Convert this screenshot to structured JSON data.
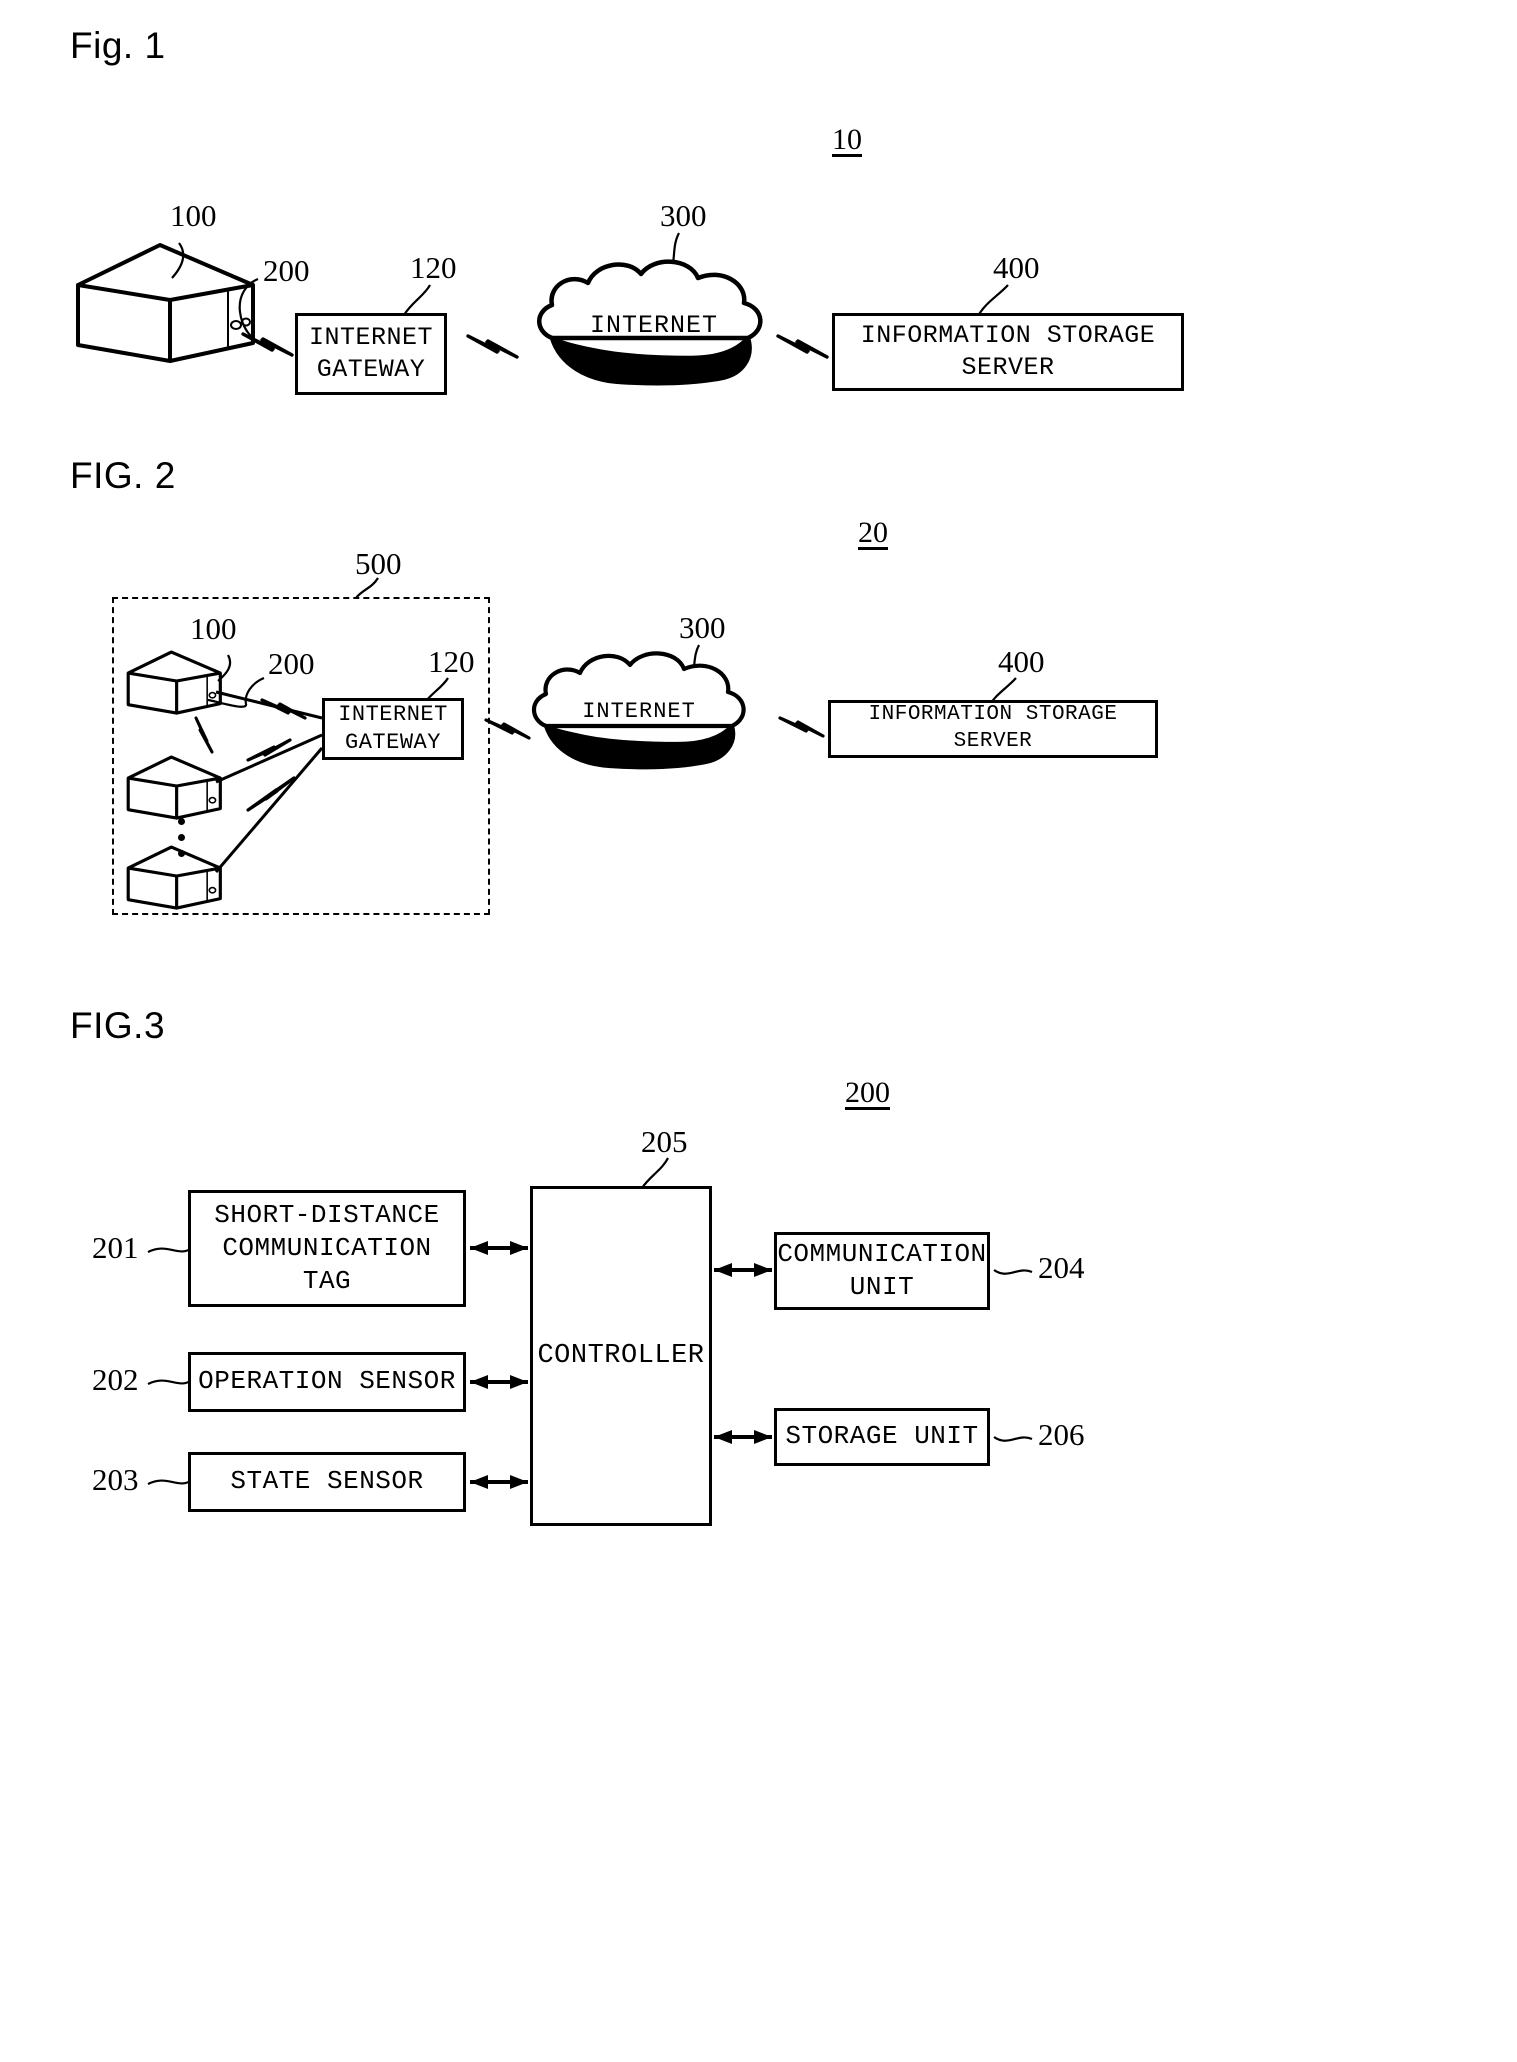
{
  "figures": [
    {
      "label": "Fig. 1",
      "system_ref": "10",
      "nodes": {
        "device_ref": "100",
        "tag_ref": "200",
        "gateway_ref": "120",
        "gateway_label": "INTERNET\nGATEWAY",
        "cloud_ref": "300",
        "cloud_label": "INTERNET",
        "server_ref": "400",
        "server_label": "INFORMATION STORAGE\nSERVER"
      }
    },
    {
      "label": "FIG. 2",
      "system_ref": "20",
      "nodes": {
        "group_ref": "500",
        "device_ref": "100",
        "tag_ref": "200",
        "gateway_ref": "120",
        "gateway_label": "INTERNET\nGATEWAY",
        "cloud_ref": "300",
        "cloud_label": "INTERNET",
        "server_ref": "400",
        "server_label": "INFORMATION STORAGE\nSERVER"
      }
    },
    {
      "label": "FIG.3",
      "system_ref": "200",
      "blocks": [
        {
          "ref": "201",
          "label": "SHORT-DISTANCE\nCOMMUNICATION\nTAG"
        },
        {
          "ref": "202",
          "label": "OPERATION SENSOR"
        },
        {
          "ref": "203",
          "label": "STATE SENSOR"
        },
        {
          "ref": "205",
          "label": "CONTROLLER"
        },
        {
          "ref": "204",
          "label": "COMMUNICATION\nUNIT"
        },
        {
          "ref": "206",
          "label": "STORAGE UNIT"
        }
      ]
    }
  ]
}
